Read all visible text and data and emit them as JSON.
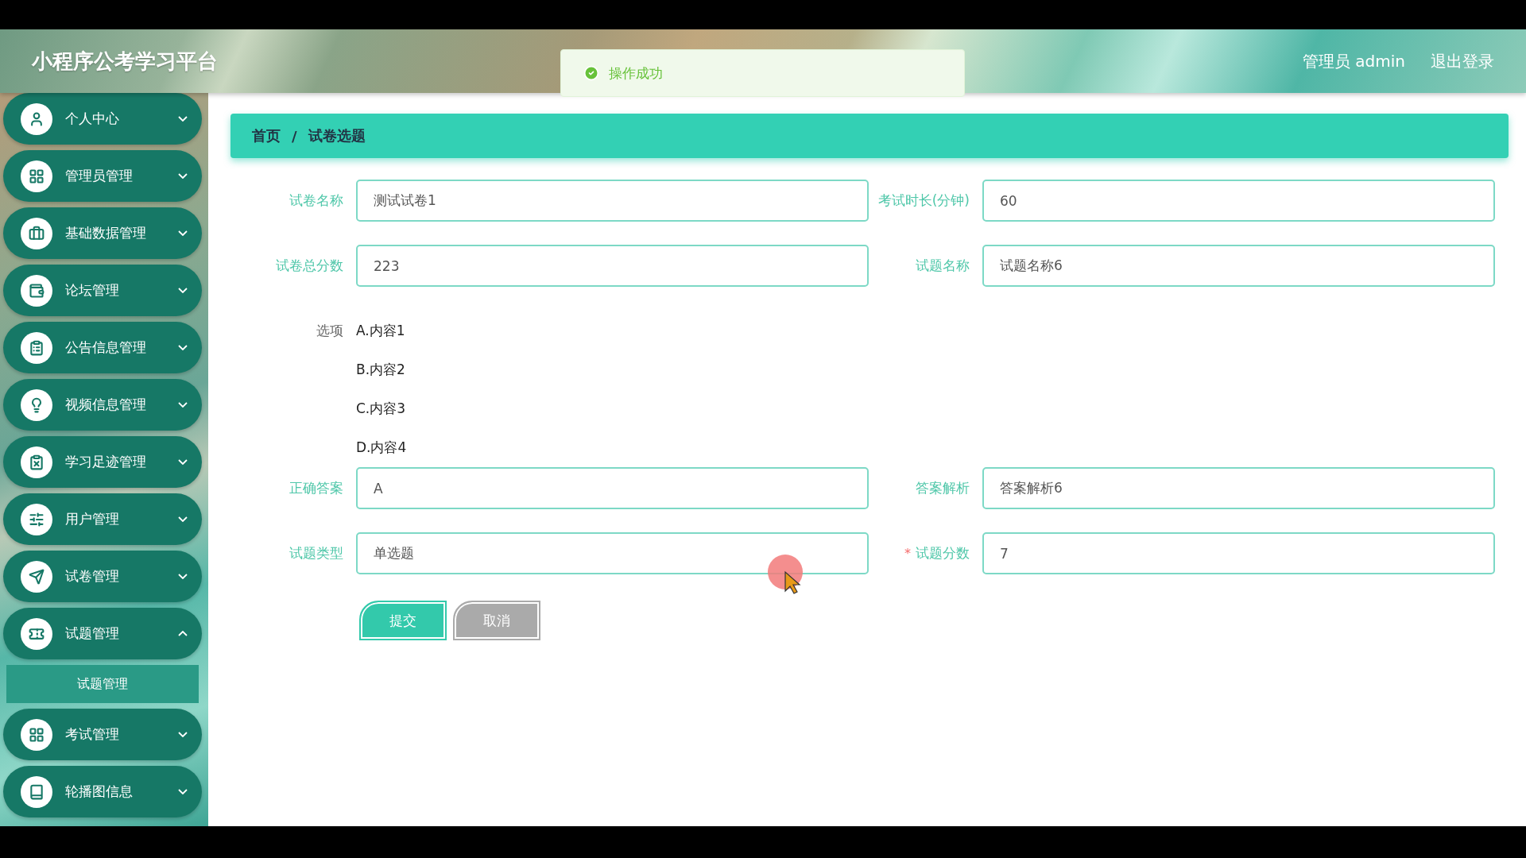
{
  "header": {
    "title": "小程序公考学习平台",
    "user_label": "管理员 admin",
    "logout": "退出登录"
  },
  "toast": {
    "kind": "success",
    "message": "操作成功"
  },
  "sidebar": {
    "items": [
      {
        "label": "个人中心",
        "expanded": false
      },
      {
        "label": "管理员管理",
        "expanded": false
      },
      {
        "label": "基础数据管理",
        "expanded": false
      },
      {
        "label": "论坛管理",
        "expanded": false
      },
      {
        "label": "公告信息管理",
        "expanded": false
      },
      {
        "label": "视频信息管理",
        "expanded": false
      },
      {
        "label": "学习足迹管理",
        "expanded": false
      },
      {
        "label": "用户管理",
        "expanded": false
      },
      {
        "label": "试卷管理",
        "expanded": false
      },
      {
        "label": "试题管理",
        "expanded": true,
        "children": [
          {
            "label": "试题管理",
            "selected": true
          }
        ]
      },
      {
        "label": "考试管理",
        "expanded": false
      },
      {
        "label": "轮播图信息",
        "expanded": false
      }
    ]
  },
  "breadcrumb": {
    "items": [
      "首页",
      "试卷选题"
    ],
    "separator": "/"
  },
  "form": {
    "required_mark": "*",
    "fields_top": [
      {
        "label": "试卷名称",
        "value": "测试试卷1",
        "required": false
      },
      {
        "label": "考试时长(分钟)",
        "value": "60",
        "required": false
      },
      {
        "label": "试卷总分数",
        "value": "223",
        "required": false
      },
      {
        "label": "试题名称",
        "value": "试题名称6",
        "required": false
      }
    ],
    "options": {
      "label": "选项",
      "items": [
        "A.内容1",
        "B.内容2",
        "C.内容3",
        "D.内容4"
      ]
    },
    "fields_bottom": [
      {
        "label": "正确答案",
        "value": "A",
        "required": false
      },
      {
        "label": "答案解析",
        "value": "答案解析6",
        "required": false
      },
      {
        "label": "试题类型",
        "value": "单选题",
        "required": false
      },
      {
        "label": "试题分数",
        "value": "7",
        "required": true
      }
    ],
    "buttons": [
      {
        "label": "提交",
        "kind": "primary"
      },
      {
        "label": "取消",
        "kind": "default"
      }
    ]
  }
}
